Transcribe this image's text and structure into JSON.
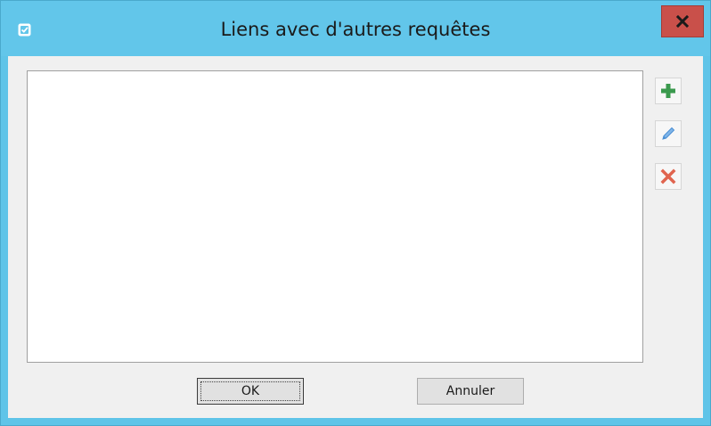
{
  "window": {
    "title": "Liens avec d'autres requêtes",
    "app_icon": "checkbox-document-icon",
    "close_icon": "close-icon"
  },
  "list": {
    "items": []
  },
  "side_toolbar": {
    "buttons": [
      {
        "icon": "plus-icon",
        "color": "#3b9a4e"
      },
      {
        "icon": "pencil-icon",
        "color": "#4a8fd4"
      },
      {
        "icon": "x-icon",
        "color": "#e0644f"
      }
    ]
  },
  "footer": {
    "ok_label": "OK",
    "cancel_label": "Annuler"
  },
  "colors": {
    "titlebar": "#62c6ea",
    "close_button": "#c9504a",
    "client_bg": "#f0f0f0"
  }
}
